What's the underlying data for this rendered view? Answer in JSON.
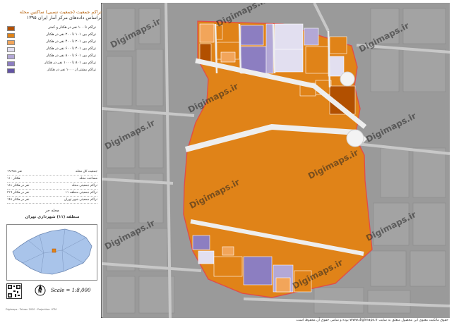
{
  "title": {
    "line1": "تراکم جمعیت (جمعیت نسبی) ساکنین محله",
    "line2": "براساس داده‌های مرکز آمار ایران ۱۳۹۵"
  },
  "legend": [
    {
      "label": "تراکم تا ۱۰۰ نفر در هکتار و کمتر",
      "color": "#b25000"
    },
    {
      "label": "تراکم بین ۱۰۱ تا ۲۰۰ نفر در هکتار",
      "color": "#e08318"
    },
    {
      "label": "تراکم بین ۲۰۱ تا ۴۰۰ نفر در هکتار",
      "color": "#f2a55a"
    },
    {
      "label": "تراکم بین ۴۰۱ تا ۶۰۰ نفر در هکتار",
      "color": "#e2dff0"
    },
    {
      "label": "تراکم بین ۶۰۱ تا ۸۰۰ نفر در هکتار",
      "color": "#b3a8d6"
    },
    {
      "label": "تراکم بین ۸۰۱ تا ۱۰۰۰ نفر در هکتار",
      "color": "#8c7ec1"
    },
    {
      "label": "تراکم بیشتر از ۱۰۰۰ نفر در هکتار",
      "color": "#6353a5"
    }
  ],
  "stats": [
    {
      "label": "جمعیت کل محله",
      "value": "۱۹،۹۸۸ نفر"
    },
    {
      "label": "مساحت محله",
      "value": "۱۱۰ هکتار"
    },
    {
      "label": "تراکم جمعیتی محله",
      "value": "۱۸۱ نفر در هکتار"
    },
    {
      "label": "تراکم جمعیتی منطقه ۱۱",
      "value": "۳۱۹ نفر در هکتار"
    },
    {
      "label": "تراکم جمعیتی شهر تهران",
      "value": "۱۴۸ نفر در هکتار"
    }
  ],
  "location": {
    "line1": "محله حر",
    "line2": "منطقه (۱۱) شهرداری تهران"
  },
  "scale": "Scale = 1:8,000",
  "north": "N",
  "credit": "Digimaps · Tehran 2020 · Projection: UTM",
  "watermark": "Digimaps.ir",
  "footer": "حقوق مالکیت معنوی این محصول متعلق به سایت www.digimaps.ir بوده و تمامی حقوق آن محفوظ است.",
  "colors": {
    "orange": "#e08318",
    "dark_orange": "#b25000",
    "light_orange": "#f2a55a",
    "lavender": "#e2dff0",
    "purple": "#8c7ec1",
    "boundary": "#e24a4a",
    "basemap": "#9a9a9a"
  }
}
